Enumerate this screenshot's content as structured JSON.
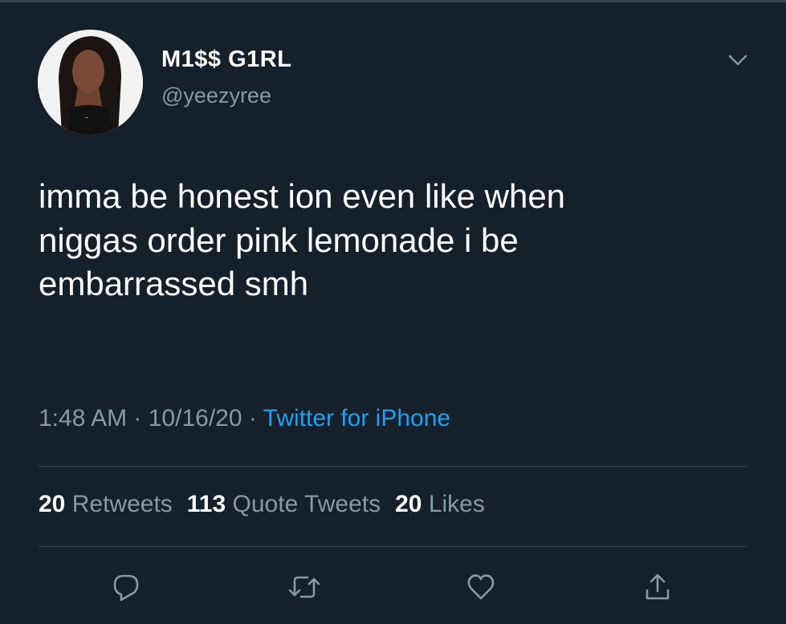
{
  "user": {
    "display_name": "M1$$ G1RL",
    "handle": "@yeezyree"
  },
  "tweet": {
    "text": "imma be honest ion even like when\nniggas order pink lemonade i be\nembarrassed smh",
    "time": "1:48 AM",
    "date": "10/16/20",
    "source": "Twitter for iPhone",
    "separator": " · "
  },
  "stats": {
    "retweets_count": "20",
    "retweets_label": "Retweets",
    "quotes_count": "113",
    "quotes_label": "Quote Tweets",
    "likes_count": "20",
    "likes_label": "Likes"
  },
  "icons": {
    "more": "chevron-down-icon",
    "reply": "reply-icon",
    "retweet": "retweet-icon",
    "like": "heart-icon",
    "share": "share-icon"
  },
  "colors": {
    "background": "#15202b",
    "text": "#ffffff",
    "secondary_text": "#8899a6",
    "link": "#1da1f2",
    "divider": "#38444d"
  }
}
